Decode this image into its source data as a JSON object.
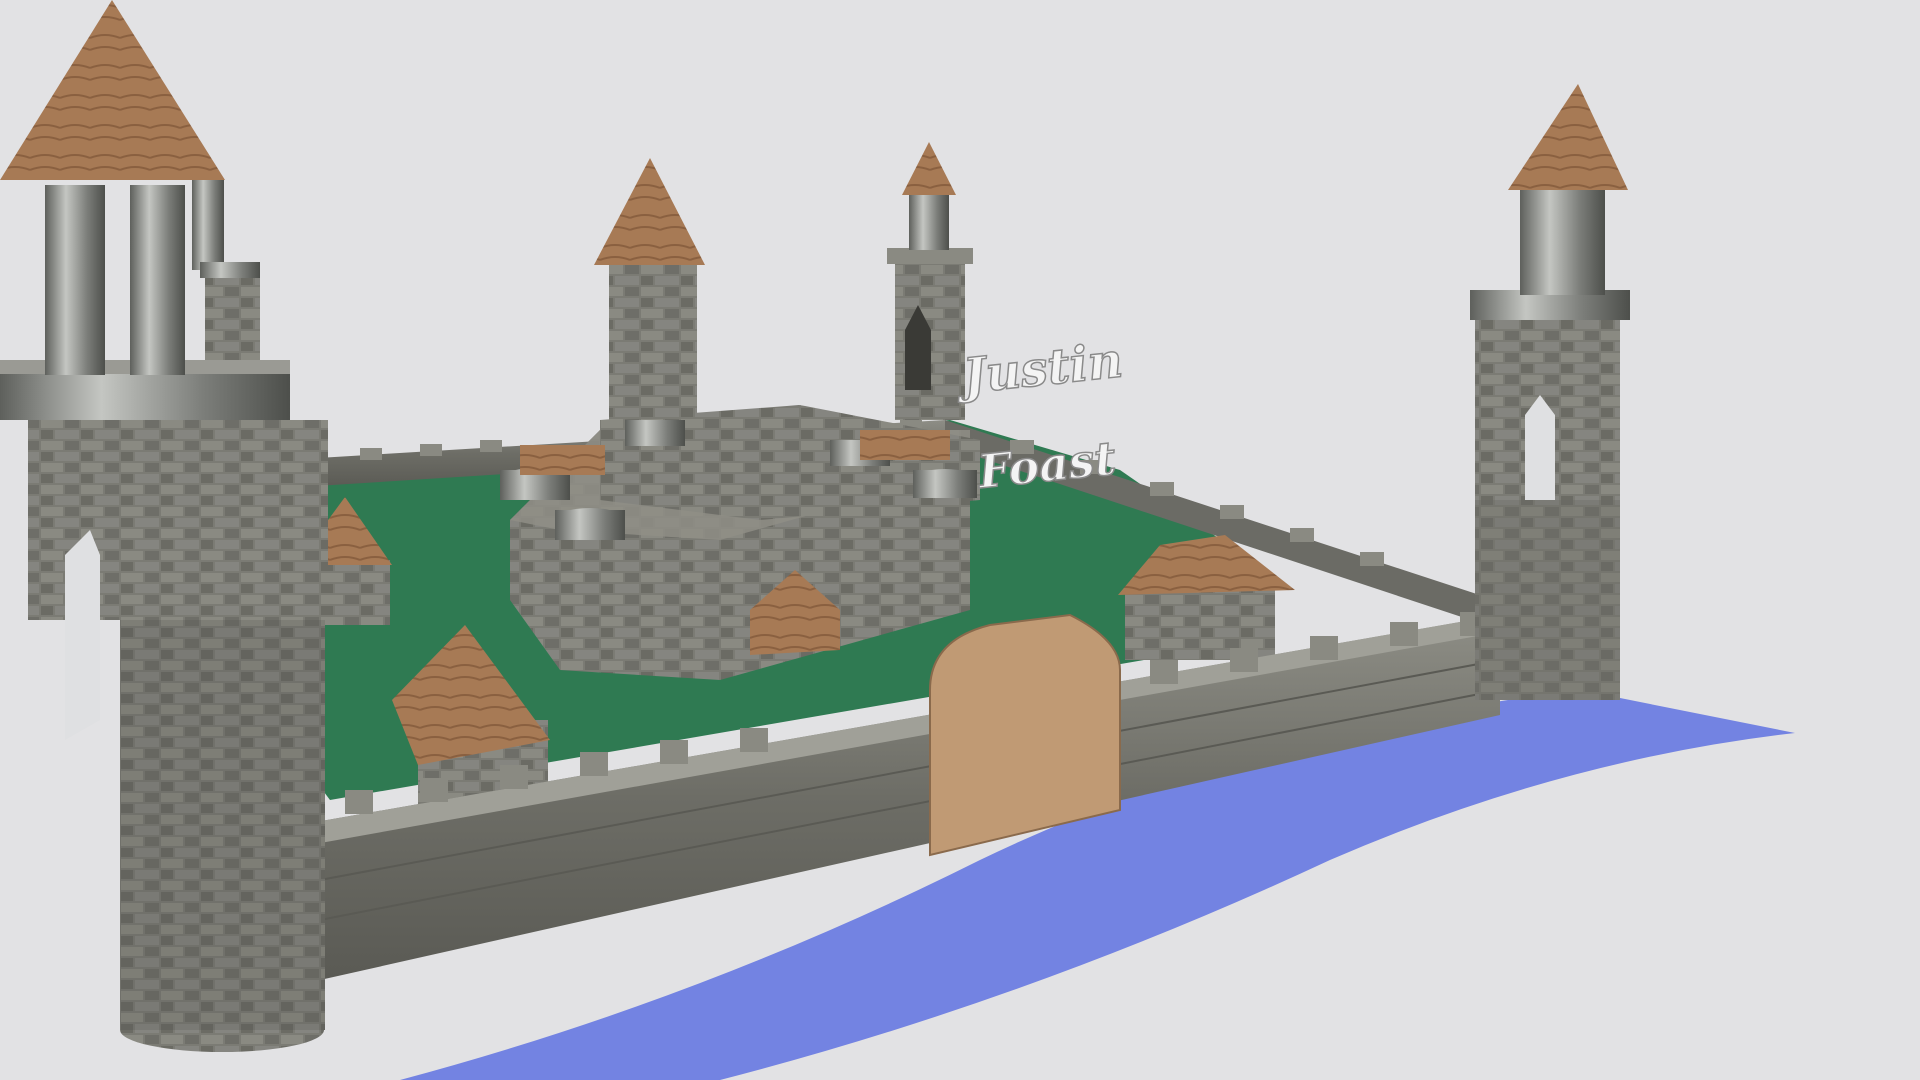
{
  "scene": {
    "label_line1": "Justin",
    "label_line2": "Foast",
    "colors": {
      "background": "#e2e2e4",
      "river": "#7383e2",
      "grass": "#2f7a52",
      "stone": "#7b7b74",
      "stone_dark": "#55554f",
      "wood": "#a77a55",
      "gate": "#c09a74",
      "text": "#f4f4f4"
    },
    "objects": [
      {
        "name": "front-left-tower",
        "icon": "tower-icon"
      },
      {
        "name": "back-left-tower",
        "icon": "tower-icon"
      },
      {
        "name": "central-keep",
        "icon": "keep-icon"
      },
      {
        "name": "back-center-tower",
        "icon": "tower-icon"
      },
      {
        "name": "right-tower",
        "icon": "tower-icon"
      },
      {
        "name": "gate",
        "icon": "gate-icon"
      },
      {
        "name": "river",
        "icon": "river-icon"
      }
    ]
  }
}
